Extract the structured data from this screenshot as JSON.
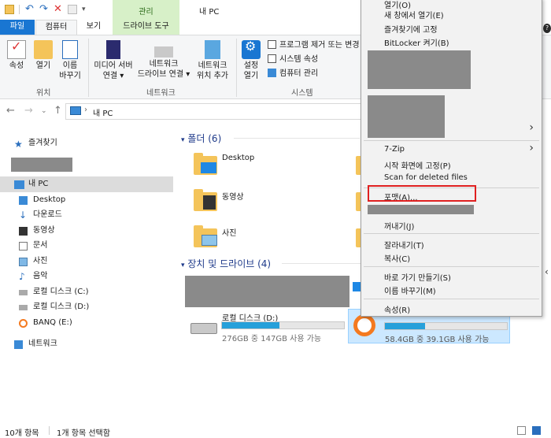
{
  "window": {
    "title": "내 PC",
    "context_tab_group": "관리"
  },
  "tabs": {
    "file": "파일",
    "computer": "컴퓨터",
    "view": "보기",
    "drive_tools": "드라이브 도구"
  },
  "ribbon": {
    "location": {
      "label": "위치",
      "properties": "속성",
      "open": "열기",
      "rename_1": "이름",
      "rename_2": "바꾸기"
    },
    "network": {
      "label": "네트워크",
      "media_1": "미디어 서버",
      "media_2": "연결 ▾",
      "map_1": "네트워크",
      "map_2": "드라이브 연결 ▾",
      "add_1": "네트워크",
      "add_2": "위치 추가"
    },
    "system": {
      "label": "시스템",
      "settings_1": "설정",
      "settings_2": "열기",
      "uninstall": "프로그램 제거 또는 변경",
      "sys_props": "시스템 속성",
      "manage": "컴퓨터 관리"
    }
  },
  "address": {
    "crumb": "내 PC"
  },
  "sidebar": {
    "items": [
      {
        "label": "즐겨찾기"
      },
      {
        "label": "내 PC"
      },
      {
        "label": "Desktop"
      },
      {
        "label": "다운로드"
      },
      {
        "label": "동영상"
      },
      {
        "label": "문서"
      },
      {
        "label": "사진"
      },
      {
        "label": "음악"
      },
      {
        "label": "로컬 디스크 (C:)"
      },
      {
        "label": "로컬 디스크 (D:)"
      },
      {
        "label": "BANQ (E:)"
      },
      {
        "label": "네트워크"
      }
    ]
  },
  "content": {
    "folders_head": "폴더 (6)",
    "folders": [
      {
        "label": "Desktop"
      },
      {
        "label": "동영상"
      },
      {
        "label": "사진"
      }
    ],
    "drives_head": "장치 및 드라이브 (4)",
    "drive_d": {
      "name": "로컬 디스크 (D:)",
      "space": "276GB 중 147GB 사용 가능",
      "used_fraction": 0.47
    },
    "drive_e": {
      "space": "58.4GB 중 39.1GB 사용 가능",
      "used_fraction": 0.33
    }
  },
  "context_menu": {
    "top_cut": "열기(O)",
    "new_window": "새 창에서 열기(E)",
    "pin_quick": "즐겨찾기에 고정",
    "bitlocker": "BitLocker 켜기(B)",
    "zip": "7-Zip",
    "pin_start": "시작 화면에 고정(P)",
    "scan": "Scan for deleted files",
    "format": "포맷(A)...",
    "eject": "꺼내기(J)",
    "cut": "잘라내기(T)",
    "copy": "복사(C)",
    "shortcut": "바로 가기 만들기(S)",
    "rename": "이름 바꾸기(M)",
    "properties": "속성(R)"
  },
  "statusbar": {
    "count": "10개 항목",
    "selected": "1개 항목 선택함"
  },
  "colors": {
    "accent": "#1976d2",
    "highlight": "#e02020",
    "folder": "#f4c45a",
    "drive_fill": "#26a0da"
  }
}
